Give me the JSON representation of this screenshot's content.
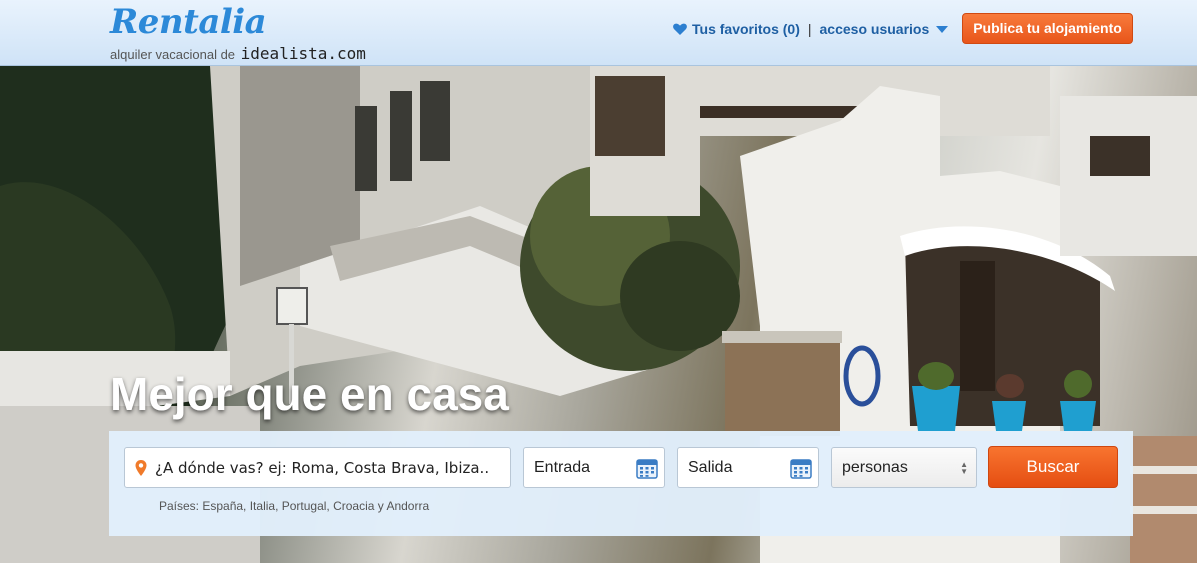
{
  "header": {
    "logo_text": "Rentalia",
    "tagline_prefix": "alquiler vacacional de",
    "tagline_brand": "idealista.com",
    "favorites_label": "Tus favoritos (0)",
    "separator": "|",
    "users_label": "acceso usuarios",
    "publish_label": "Publica tu alojamiento"
  },
  "hero": {
    "title": "Mejor que en casa"
  },
  "search": {
    "where_placeholder": "¿A dónde vas? ej: Roma, Costa Brava, Ibiza..",
    "checkin_label": "Entrada",
    "checkout_label": "Salida",
    "people_selected": "personas",
    "submit_label": "Buscar",
    "countries_note": "Países: España, Italia, Portugal, Croacia y Andorra"
  },
  "colors": {
    "accent_orange": "#e8551a",
    "link_blue": "#1e5fa3",
    "logo_blue": "#2c89d8"
  },
  "icons": [
    "heart-icon",
    "chevron-down-icon",
    "location-pin-icon",
    "calendar-icon",
    "select-arrows-icon"
  ]
}
